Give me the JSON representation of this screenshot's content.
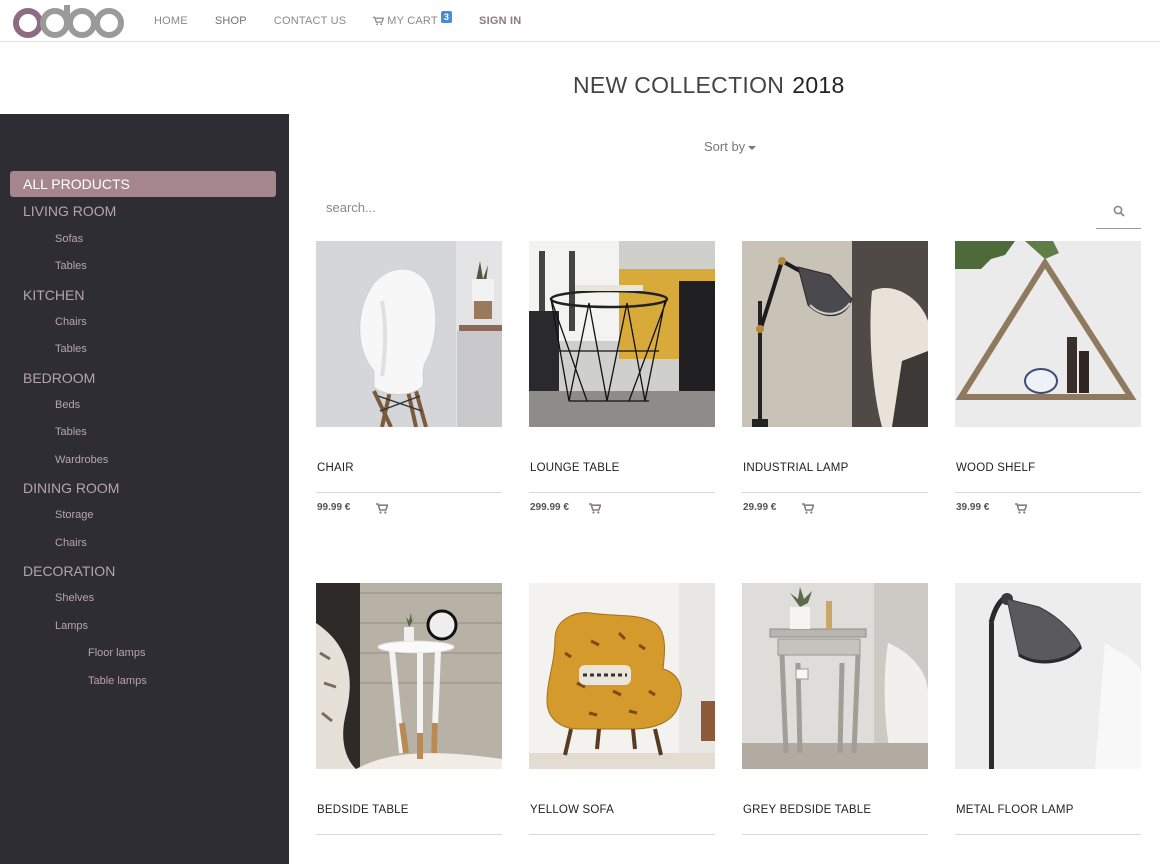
{
  "brand": {
    "name": "odoo",
    "color": "#8f8f8f",
    "accent": "#a5868f"
  },
  "nav": {
    "items": [
      {
        "label": "HOME"
      },
      {
        "label": "SHOP"
      },
      {
        "label": "CONTACT US"
      },
      {
        "label": "MY CART",
        "badge": "3"
      },
      {
        "label": "SIGN IN"
      }
    ]
  },
  "page": {
    "title": "NEW COLLECTION",
    "year": "2018"
  },
  "sort": {
    "label": "Sort by"
  },
  "search": {
    "placeholder": "search...",
    "value": ""
  },
  "sidebar": {
    "active": "ALL PRODUCTS",
    "categories": [
      {
        "label": "LIVING ROOM",
        "children": [
          "Sofas",
          "Tables"
        ]
      },
      {
        "label": "KITCHEN",
        "children": [
          "Chairs",
          "Tables"
        ]
      },
      {
        "label": "BEDROOM",
        "children": [
          "Beds",
          "Tables",
          "Wardrobes"
        ]
      },
      {
        "label": "DINING ROOM",
        "children": [
          "Storage",
          "Chairs"
        ]
      },
      {
        "label": "DECORATION",
        "children": [
          "Shelves",
          "Lamps"
        ],
        "grandchildren": [
          "Floor lamps",
          "Table lamps"
        ]
      }
    ]
  },
  "products": [
    {
      "name": "CHAIR",
      "price": "99.99 €"
    },
    {
      "name": "LOUNGE TABLE",
      "price": "299.99 €"
    },
    {
      "name": "INDUSTRIAL LAMP",
      "price": "29.99 €"
    },
    {
      "name": "WOOD SHELF",
      "price": "39.99 €"
    },
    {
      "name": "BEDSIDE TABLE"
    },
    {
      "name": "YELLOW SOFA"
    },
    {
      "name": "GREY BEDSIDE TABLE"
    },
    {
      "name": "METAL FLOOR LAMP"
    }
  ]
}
